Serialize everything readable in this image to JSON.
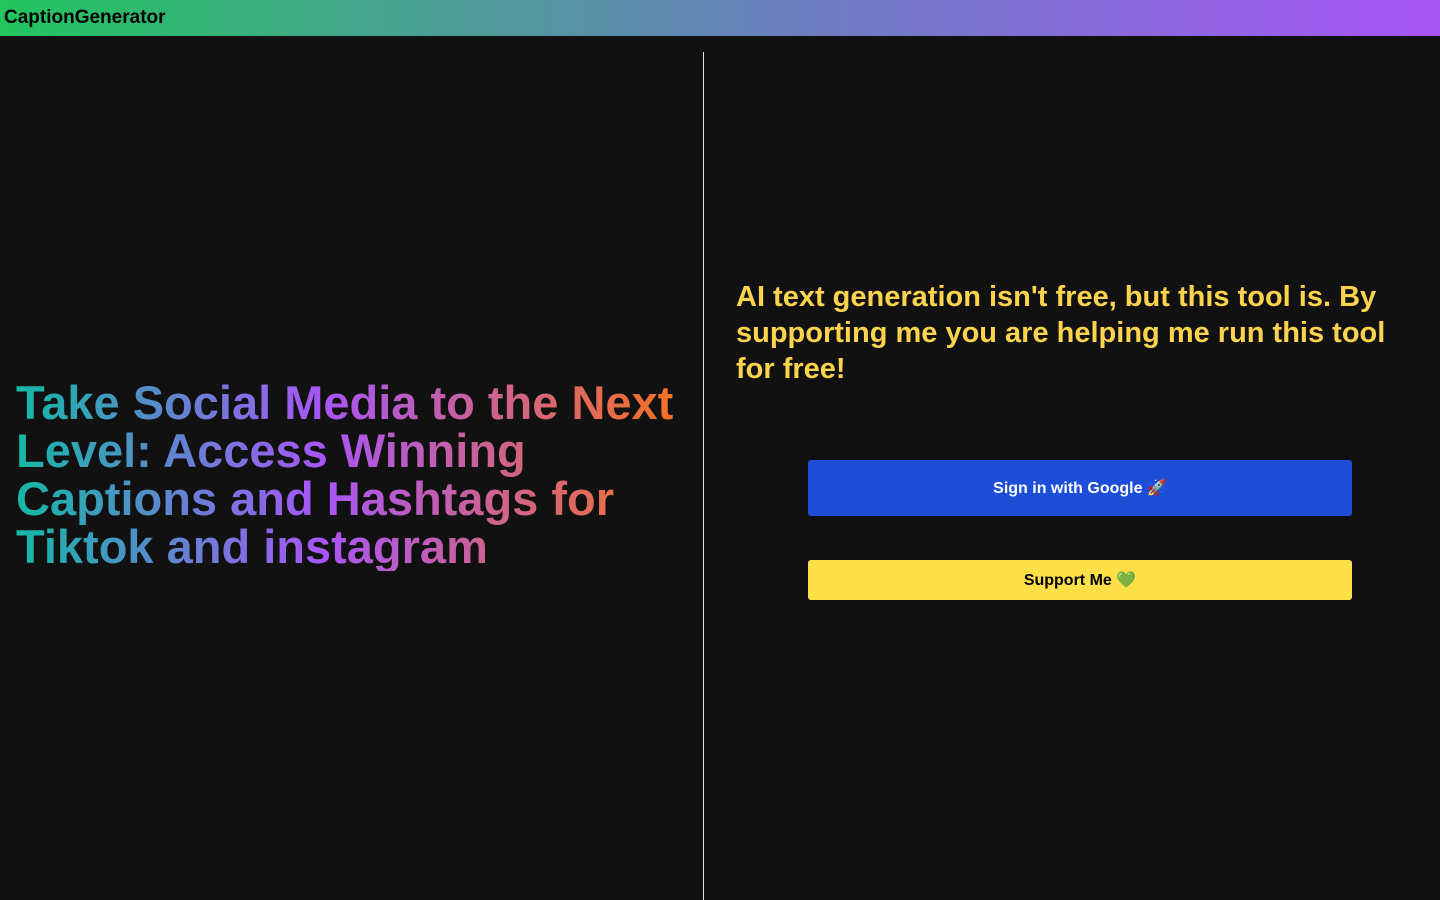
{
  "header": {
    "brand": "CaptionGenerator"
  },
  "hero": {
    "headline": "Take Social Media to the Next Level: Access Winning Captions and Hashtags for Tiktok and instagram"
  },
  "support": {
    "message": "AI text generation isn't free, but this tool is. By supporting me you are helping me run this tool for free!",
    "google_button_label": "Sign in with Google 🚀",
    "support_button_label": "Support Me 💚"
  },
  "colors": {
    "google_button": "#1d4ed8",
    "support_button": "#fde047",
    "support_text": "#fcd34d",
    "background": "#111111"
  }
}
